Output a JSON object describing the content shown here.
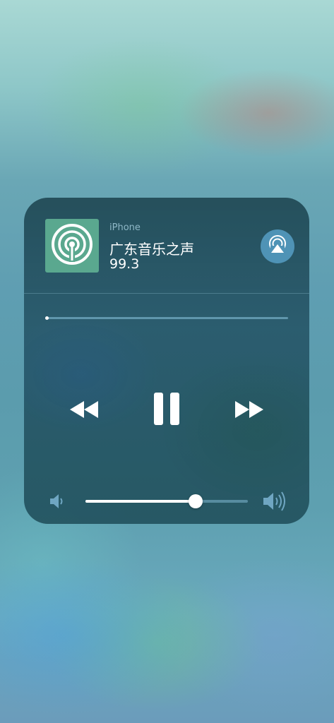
{
  "now_playing": {
    "source_label": "iPhone",
    "title": "广东音乐之声",
    "subtitle": "99.3",
    "artwork_icon": "radio-podcast-icon",
    "artwork_color": "#5aa88f",
    "progress": 0.0
  },
  "controls": {
    "airplay_icon": "airplay-icon",
    "rewind_icon": "rewind-icon",
    "pause_icon": "pause-icon",
    "forward_icon": "fast-forward-icon"
  },
  "volume": {
    "level": 0.68,
    "low_icon": "volume-low-icon",
    "high_icon": "volume-high-icon"
  },
  "colors": {
    "accent": "#4f93b6",
    "panel": "#24576a",
    "text": "#ffffff",
    "source_text": "#8fb8c8"
  }
}
